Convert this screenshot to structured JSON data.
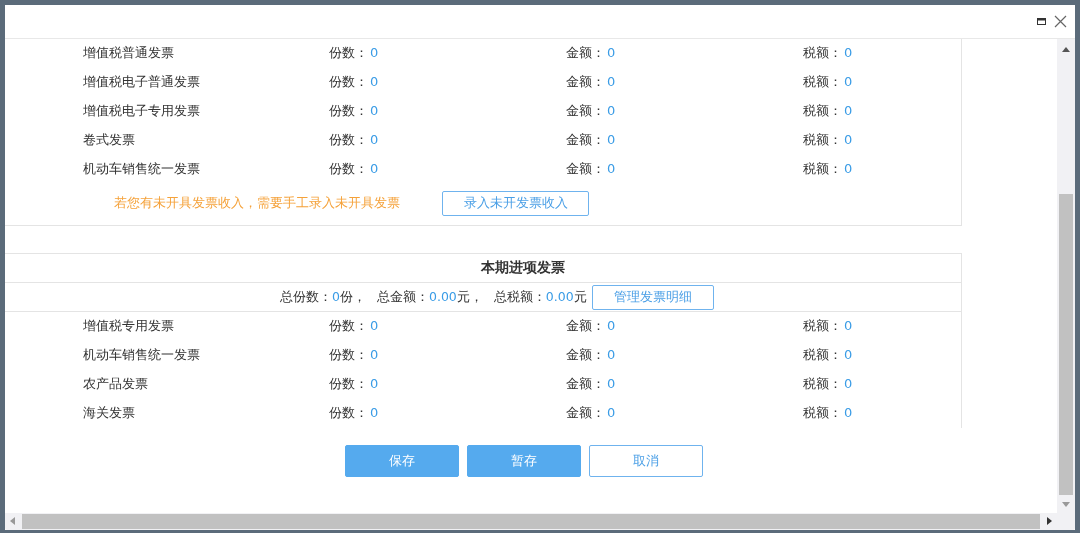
{
  "output_section": {
    "rows": [
      {
        "name": "增值税普通发票",
        "count_label": "份数：",
        "count": "0",
        "amount_label": "金额：",
        "amount": "0",
        "tax_label": "税额：",
        "tax": "0"
      },
      {
        "name": "增值税电子普通发票",
        "count_label": "份数：",
        "count": "0",
        "amount_label": "金额：",
        "amount": "0",
        "tax_label": "税额：",
        "tax": "0"
      },
      {
        "name": "增值税电子专用发票",
        "count_label": "份数：",
        "count": "0",
        "amount_label": "金额：",
        "amount": "0",
        "tax_label": "税额：",
        "tax": "0"
      },
      {
        "name": "卷式发票",
        "count_label": "份数：",
        "count": "0",
        "amount_label": "金额：",
        "amount": "0",
        "tax_label": "税额：",
        "tax": "0"
      },
      {
        "name": "机动车销售统一发票",
        "count_label": "份数：",
        "count": "0",
        "amount_label": "金额：",
        "amount": "0",
        "tax_label": "税额：",
        "tax": "0"
      }
    ],
    "hint": "若您有未开具发票收入，需要手工录入未开具发票",
    "button": "录入未开发票收入"
  },
  "input_section": {
    "title": "本期进项发票",
    "summary": [
      {
        "label": "总份数：",
        "value": "0",
        "unit": "份，"
      },
      {
        "label": "总金额：",
        "value": "0.00",
        "unit": "元，"
      },
      {
        "label": "总税额：",
        "value": "0.00",
        "unit": "元"
      }
    ],
    "manage_button": "管理发票明细",
    "rows": [
      {
        "name": "增值税专用发票",
        "count_label": "份数：",
        "count": "0",
        "amount_label": "金额：",
        "amount": "0",
        "tax_label": "税额：",
        "tax": "0"
      },
      {
        "name": "机动车销售统一发票",
        "count_label": "份数：",
        "count": "0",
        "amount_label": "金额：",
        "amount": "0",
        "tax_label": "税额：",
        "tax": "0"
      },
      {
        "name": "农产品发票",
        "count_label": "份数：",
        "count": "0",
        "amount_label": "金额：",
        "amount": "0",
        "tax_label": "税额：",
        "tax": "0"
      },
      {
        "name": "海关发票",
        "count_label": "份数：",
        "count": "0",
        "amount_label": "金额：",
        "amount": "0",
        "tax_label": "税额：",
        "tax": "0"
      }
    ]
  },
  "buttons": [
    {
      "label": "保存",
      "kind": "primary"
    },
    {
      "label": "暂存",
      "kind": "primary"
    },
    {
      "label": "取消",
      "kind": "secondary"
    }
  ]
}
